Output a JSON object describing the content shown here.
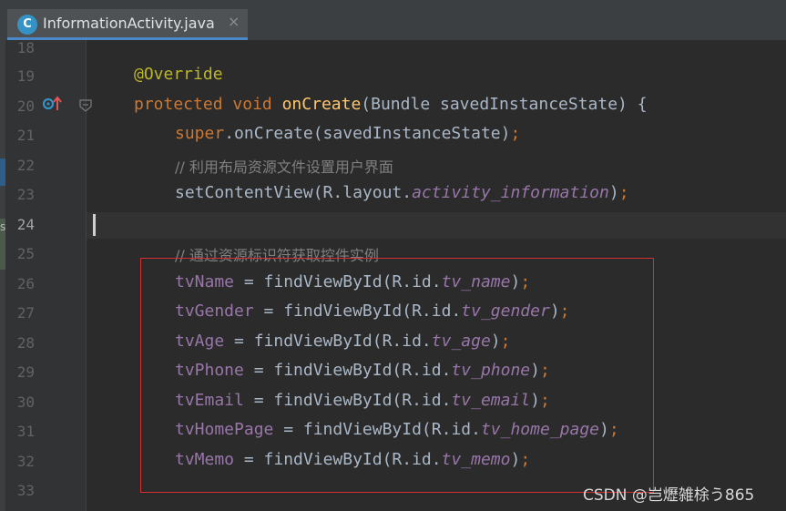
{
  "tab": {
    "icon_letter": "C",
    "title": "InformationActivity.java",
    "close": "×"
  },
  "left_strip_letter": "s",
  "line_numbers": [
    "18",
    "19",
    "20",
    "21",
    "22",
    "23",
    "24",
    "25",
    "26",
    "27",
    "28",
    "29",
    "30",
    "31",
    "32",
    "33"
  ],
  "code": {
    "l19_ann": "@Override",
    "l20_kw1": "protected",
    "l20_kw2": "void",
    "l20_fn": "onCreate",
    "l20_rest": "(Bundle savedInstanceState) {",
    "l21_kw": "super",
    "l21_rest": ".onCreate(savedInstanceState)",
    "l21_semi": ";",
    "l22_comment": "// 利用布局资源文件设置用户界面",
    "l23_a": "setContentView(R.layout.",
    "l23_b": "activity_information",
    "l23_c": ")",
    "l23_semi": ";",
    "l25_comment": "// 通过资源标识符获取控件实例",
    "assignments": [
      {
        "field": "tvName",
        "mid": " = findViewById(R.id.",
        "res": "tv_name"
      },
      {
        "field": "tvGender",
        "mid": " = findViewById(R.id.",
        "res": "tv_gender"
      },
      {
        "field": "tvAge",
        "mid": " = findViewById(R.id.",
        "res": "tv_age"
      },
      {
        "field": "tvPhone",
        "mid": " = findViewById(R.id.",
        "res": "tv_phone"
      },
      {
        "field": "tvEmail",
        "mid": " = findViewById(R.id.",
        "res": "tv_email"
      },
      {
        "field": "tvHomePage",
        "mid": " = findViewById(R.id.",
        "res": "tv_home_page"
      },
      {
        "field": "tvMemo",
        "mid": " = findViewById(R.id.",
        "res": "tv_memo"
      }
    ],
    "close_paren": ")",
    "semicolon": ";"
  },
  "watermark": "CSDN @岂爏雑梌う865",
  "colors": {
    "background": "#2b2b2b",
    "keyword": "#cc7832",
    "annotation": "#bbb529",
    "method": "#ffc66d",
    "field": "#9876aa",
    "comment": "#808080",
    "highlight_box": "#d03030"
  }
}
